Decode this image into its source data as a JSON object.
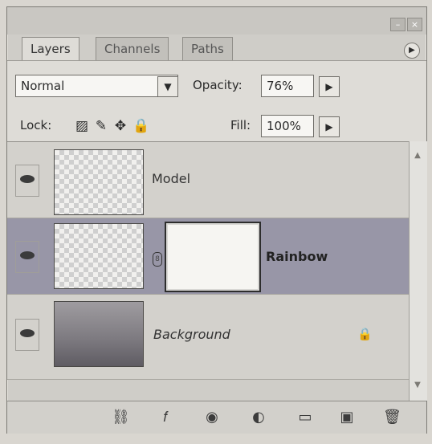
{
  "tabs": [
    {
      "label": "Layers"
    },
    {
      "label": "Channels"
    },
    {
      "label": "Paths"
    }
  ],
  "blend_mode": "Normal",
  "opacity": {
    "label": "Opacity:",
    "value": "76%"
  },
  "fill": {
    "label": "Fill:",
    "value": "100%"
  },
  "lock": {
    "label": "Lock:"
  },
  "layers": [
    {
      "name": "Model"
    },
    {
      "name": "Rainbow"
    },
    {
      "name": "Background"
    }
  ],
  "icons": {
    "minimize": "minimize-icon",
    "close": "close-icon",
    "panel_menu": "panel-menu-icon",
    "dropdown": "dropdown-icon",
    "arrow": "arrow-right-icon",
    "lock_transparent": "checkerboard-lock-icon",
    "lock_brush": "brush-lock-icon",
    "lock_move": "move-lock-icon",
    "lock_all": "padlock-icon",
    "eye": "eye-icon",
    "link": "link-icon",
    "fx": "fx-icon",
    "mask": "mask-icon",
    "adjust": "adjustment-icon",
    "folder": "folder-icon",
    "new_layer": "new-layer-icon",
    "trash": "trash-icon"
  }
}
